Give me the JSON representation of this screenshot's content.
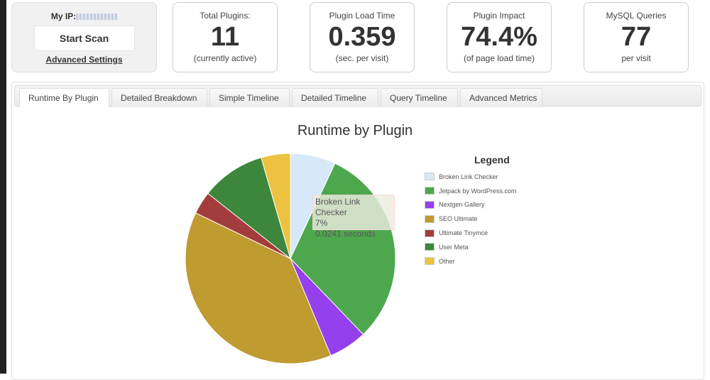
{
  "scan_card": {
    "ip_label": "My IP:",
    "ip_value_redacted": true,
    "start_scan_label": "Start Scan",
    "advanced_settings_label": "Advanced Settings"
  },
  "stats": [
    {
      "label": "Total Plugins:",
      "value": "11",
      "sub": "(currently active)"
    },
    {
      "label": "Plugin Load Time",
      "value": "0.359",
      "sub": "(sec. per visit)"
    },
    {
      "label": "Plugin Impact",
      "value": "74.4%",
      "sub": "(of page load time)"
    },
    {
      "label": "MySQL Queries",
      "value": "77",
      "sub": "per visit"
    }
  ],
  "tabs": [
    {
      "label": "Runtime By Plugin",
      "active": true
    },
    {
      "label": "Detailed Breakdown",
      "active": false
    },
    {
      "label": "Simple Timeline",
      "active": false
    },
    {
      "label": "Detailed Timeline",
      "active": false
    },
    {
      "label": "Query Timeline",
      "active": false
    },
    {
      "label": "Advanced Metrics",
      "active": false
    }
  ],
  "tooltip": {
    "name": "Broken Link Checker",
    "percent": "7%",
    "seconds": "0.0241 seconds"
  },
  "chart_data": {
    "type": "pie",
    "title": "Runtime by Plugin",
    "legend_title": "Legend",
    "legend_position": "right",
    "categories": [
      "Broken Link Checker",
      "Jetpack by WordPress.com",
      "Nextgen Gallery",
      "SEO Ultimate",
      "Ultimate Tinymce",
      "User Meta",
      "Other"
    ],
    "values": [
      7.0,
      30.9,
      5.9,
      38.5,
      3.5,
      9.9,
      4.5
    ],
    "unit": "percent of plugin runtime",
    "colors": [
      "#d7e9f8",
      "#4da84d",
      "#9440ed",
      "#bf9b30",
      "#a33d3d",
      "#3c873c",
      "#edc240"
    ]
  }
}
